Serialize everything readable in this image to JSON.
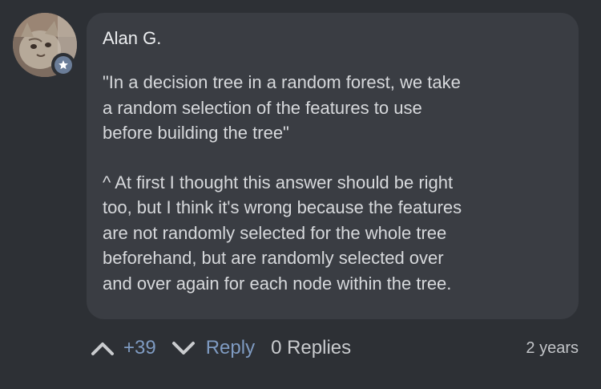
{
  "comment": {
    "author": "Alan G.",
    "paragraphs": [
      "\"In a decision tree in a random forest, we take\na random selection of the features to use\nbefore building the tree\"",
      "^ At first I thought this answer should be right\ntoo, but I think it's wrong because the features\nare not randomly selected for the whole tree\nbeforehand, but are randomly selected over\nand over again for each node within the tree."
    ],
    "score": "+39",
    "reply_label": "Reply",
    "replies_label": "0 Replies",
    "age": "2 years"
  },
  "icons": {
    "upvote": "chevron-up-icon",
    "downvote": "chevron-down-icon",
    "badge": "star-icon"
  },
  "colors": {
    "background": "#2d3035",
    "bubble": "#3a3d43",
    "accent": "#7f9bc2",
    "badge": "#6b7d98"
  }
}
